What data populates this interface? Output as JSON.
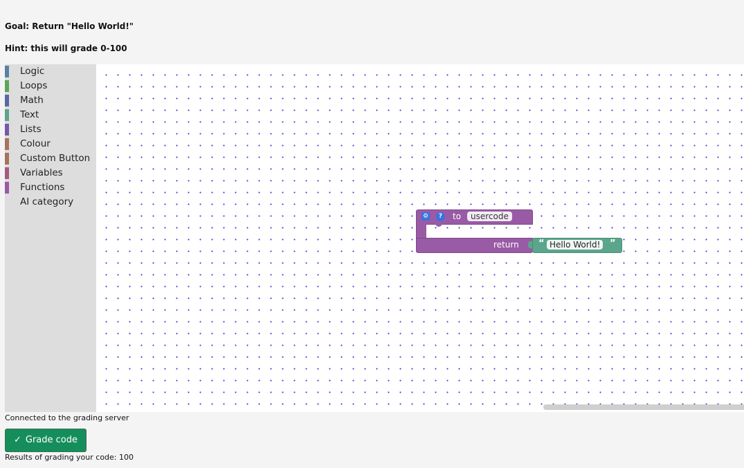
{
  "header": {
    "goal": "Goal: Return \"Hello World!\"",
    "hint": "Hint: this will grade 0-100"
  },
  "toolbox": {
    "categories": [
      {
        "label": "Logic",
        "color": "#5b80a5"
      },
      {
        "label": "Loops",
        "color": "#5ba55b"
      },
      {
        "label": "Math",
        "color": "#5b67a5"
      },
      {
        "label": "Text",
        "color": "#5ba58c"
      },
      {
        "label": "Lists",
        "color": "#745ba5"
      },
      {
        "label": "Colour",
        "color": "#a5745b"
      },
      {
        "label": "Custom Button",
        "color": "#a5745b"
      },
      {
        "label": "Variables",
        "color": "#a55b80"
      },
      {
        "label": "Functions",
        "color": "#995ba5"
      },
      {
        "label": "AI category",
        "color": ""
      }
    ]
  },
  "block": {
    "to_label": "to",
    "function_name": "usercode",
    "return_label": "return",
    "open_quote": "“",
    "text_value": "Hello World!",
    "close_quote": "”"
  },
  "status": {
    "connected": "Connected to the grading server",
    "grade_button": "Grade code",
    "results": "Results of grading your code: 100"
  }
}
